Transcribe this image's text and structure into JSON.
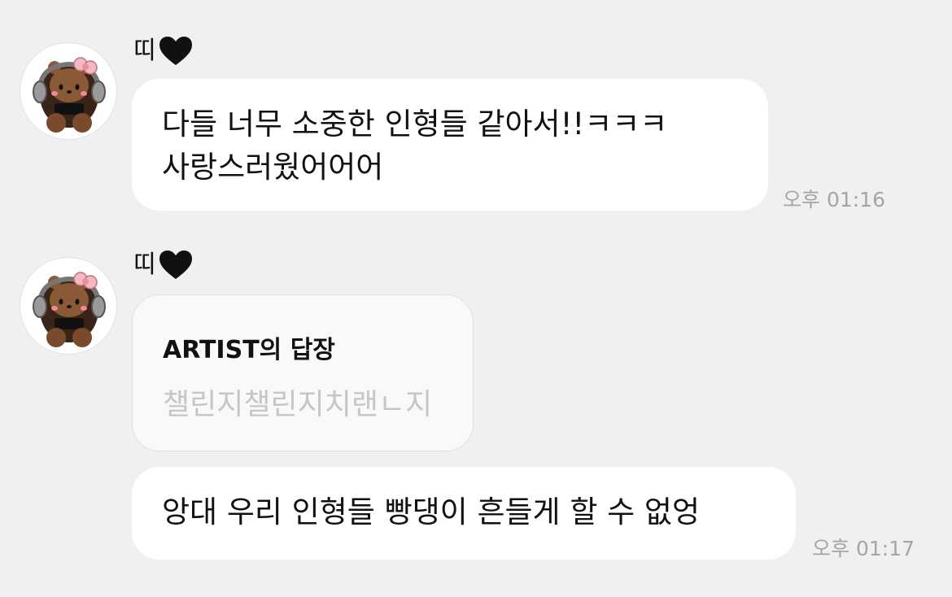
{
  "messages": [
    {
      "sender": "띠",
      "sender_emoji_icon": "black-heart-icon",
      "text": "다들 너무 소중한 인형들 같아서!!ㅋㅋㅋ\n사랑스러웠어어어",
      "time": "오후 01:16"
    },
    {
      "sender": "띠",
      "sender_emoji_icon": "black-heart-icon",
      "reply": {
        "title": "ARTIST의 답장",
        "quote": "챌린지챌린지치랜ㄴ지"
      },
      "text": "앙대 우리 인형들 빵댕이 흔들게 할 수 없엉",
      "time": "오후 01:17"
    }
  ],
  "colors": {
    "background": "#f0f0f0",
    "bubble": "#ffffff",
    "reply_card": "#f9f9f9",
    "timestamp": "#a5a5a5",
    "quote_text": "#c6c6c6"
  }
}
